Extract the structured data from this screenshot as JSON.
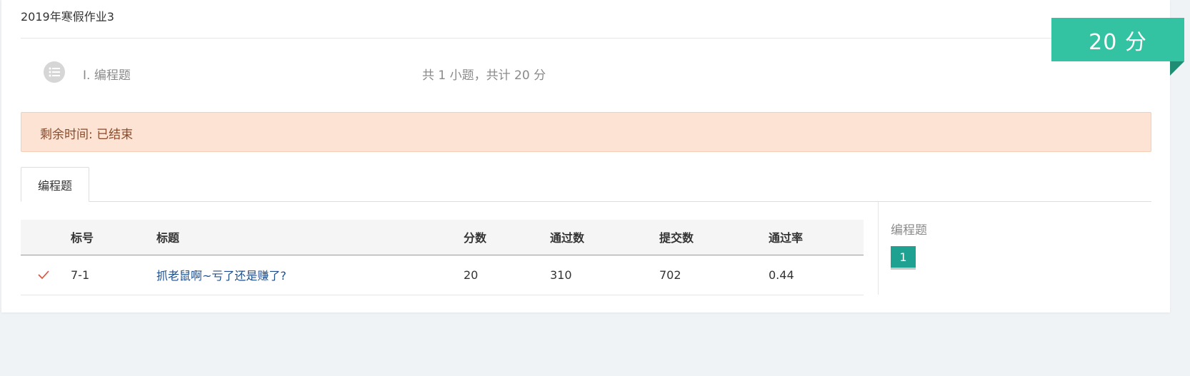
{
  "assignment": {
    "title": "2019年寒假作业3"
  },
  "section": {
    "label": "I.  编程题",
    "summary": "共 1 小题，共计 20 分",
    "icon": "list-icon"
  },
  "score_badge": {
    "text": "20 分",
    "color": "#33c3a2"
  },
  "alert": {
    "text": "剩余时间: 已结束",
    "color": "#fde3d3"
  },
  "tabs": [
    {
      "label": "编程题",
      "active": true
    }
  ],
  "table": {
    "headers": [
      "",
      "标号",
      "标题",
      "分数",
      "通过数",
      "提交数",
      "通过率"
    ],
    "rows": [
      {
        "status": "check-icon",
        "number": "7-1",
        "title": "抓老鼠啊~亏了还是赚了?",
        "score": "20",
        "passed": "310",
        "submitted": "702",
        "pass_rate": "0.44"
      }
    ]
  },
  "side_panel": {
    "label": "编程题",
    "question_numbers": [
      "1"
    ],
    "accent": "#1fa192"
  }
}
